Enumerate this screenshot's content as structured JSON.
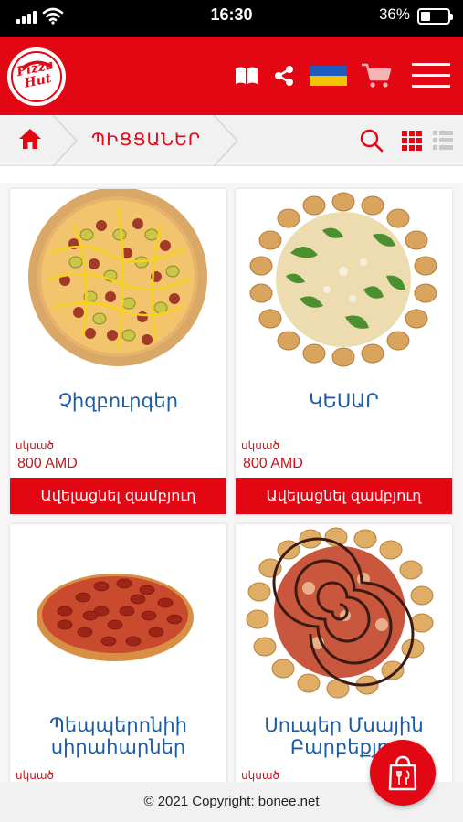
{
  "status_bar": {
    "time": "16:30",
    "battery_percent": "36%",
    "battery_level": 0.36
  },
  "header": {
    "logo_text": "Pizza Hut",
    "icons": [
      "book-icon",
      "share-icon",
      "flag-ukraine-icon",
      "cart-icon",
      "hamburger-menu-icon"
    ],
    "brand_color": "#e30613"
  },
  "breadcrumb": {
    "home_icon": "home-icon",
    "current": "ՊԻՑՑԱՆԵՐ",
    "view_icons": [
      "search-icon",
      "grid-view-icon",
      "list-view-icon"
    ]
  },
  "products": [
    {
      "name": "Չիզբուրգեր",
      "from_label": "սկսած",
      "price": "800 AMD",
      "button": "Ավելացնել զամբյուղ"
    },
    {
      "name": "ԿԵՍԱՐ",
      "from_label": "սկսած",
      "price": "800 AMD",
      "button": "Ավելացնել զամբյուղ"
    },
    {
      "name": "Պեպպերոնիի սիրահարներ",
      "from_label": "սկսած",
      "price": "",
      "button": ""
    },
    {
      "name": "Սուպեր Մսային Բարբեքյու",
      "from_label": "սկսած",
      "price": "",
      "button": ""
    }
  ],
  "footer": {
    "text": "© 2021 Copyright: bonee.net"
  },
  "fab": {
    "icon": "shopping-bag-icon"
  }
}
